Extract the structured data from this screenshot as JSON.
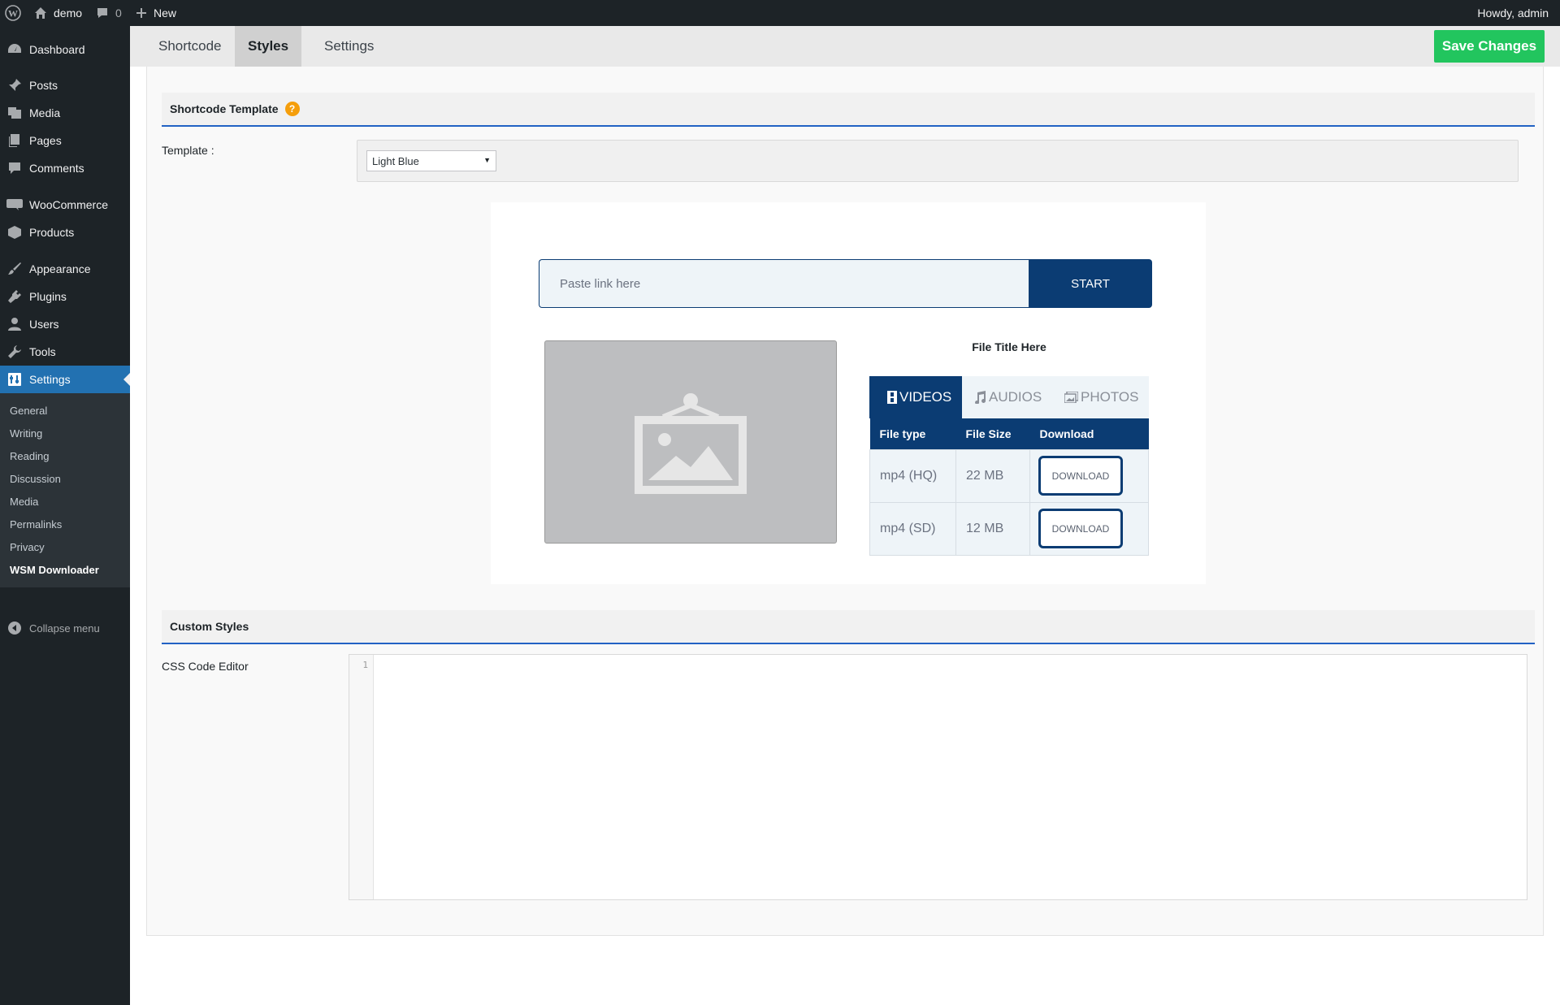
{
  "adminbar": {
    "site_name": "demo",
    "comments_count": "0",
    "new_label": "New",
    "howdy": "Howdy, admin"
  },
  "sidebar": {
    "items": [
      {
        "label": "Dashboard",
        "icon": "dashboard-icon"
      },
      {
        "label": "Posts",
        "icon": "pin-icon"
      },
      {
        "label": "Media",
        "icon": "media-icon"
      },
      {
        "label": "Pages",
        "icon": "pages-icon"
      },
      {
        "label": "Comments",
        "icon": "comment-icon"
      },
      {
        "label": "WooCommerce",
        "icon": "woo-icon"
      },
      {
        "label": "Products",
        "icon": "box-icon"
      },
      {
        "label": "Appearance",
        "icon": "brush-icon"
      },
      {
        "label": "Plugins",
        "icon": "plug-icon"
      },
      {
        "label": "Users",
        "icon": "user-icon"
      },
      {
        "label": "Tools",
        "icon": "wrench-icon"
      },
      {
        "label": "Settings",
        "icon": "settings-icon"
      }
    ],
    "submenu": [
      "General",
      "Writing",
      "Reading",
      "Discussion",
      "Media",
      "Permalinks",
      "Privacy",
      "WSM Downloader"
    ],
    "collapse_label": "Collapse menu"
  },
  "tabs": [
    {
      "label": "Shortcode",
      "active": false
    },
    {
      "label": "Styles",
      "active": true
    },
    {
      "label": "Settings",
      "active": false
    }
  ],
  "save_label": "Save Changes",
  "shortcode_template": {
    "heading": "Shortcode Template",
    "help": "?",
    "template_label": "Template :",
    "template_value": "Light Blue"
  },
  "preview": {
    "input_placeholder": "Paste link here",
    "start_label": "START",
    "file_title": "File Title Here",
    "media_tabs": [
      "VIDEOS",
      "AUDIOS",
      "PHOTOS"
    ],
    "columns": [
      "File type",
      "File Size",
      "Download"
    ],
    "rows": [
      {
        "type": "mp4 (HQ)",
        "size": "22 MB",
        "action": "DOWNLOAD"
      },
      {
        "type": "mp4 (SD)",
        "size": "12 MB",
        "action": "DOWNLOAD"
      }
    ]
  },
  "custom_styles": {
    "heading": "Custom Styles",
    "editor_label": "CSS Code Editor",
    "line_number": "1"
  },
  "colors": {
    "accent": "#2271b1",
    "save": "#22c55e",
    "preview_primary": "#0b3c73",
    "section_rule": "#2262c4"
  }
}
